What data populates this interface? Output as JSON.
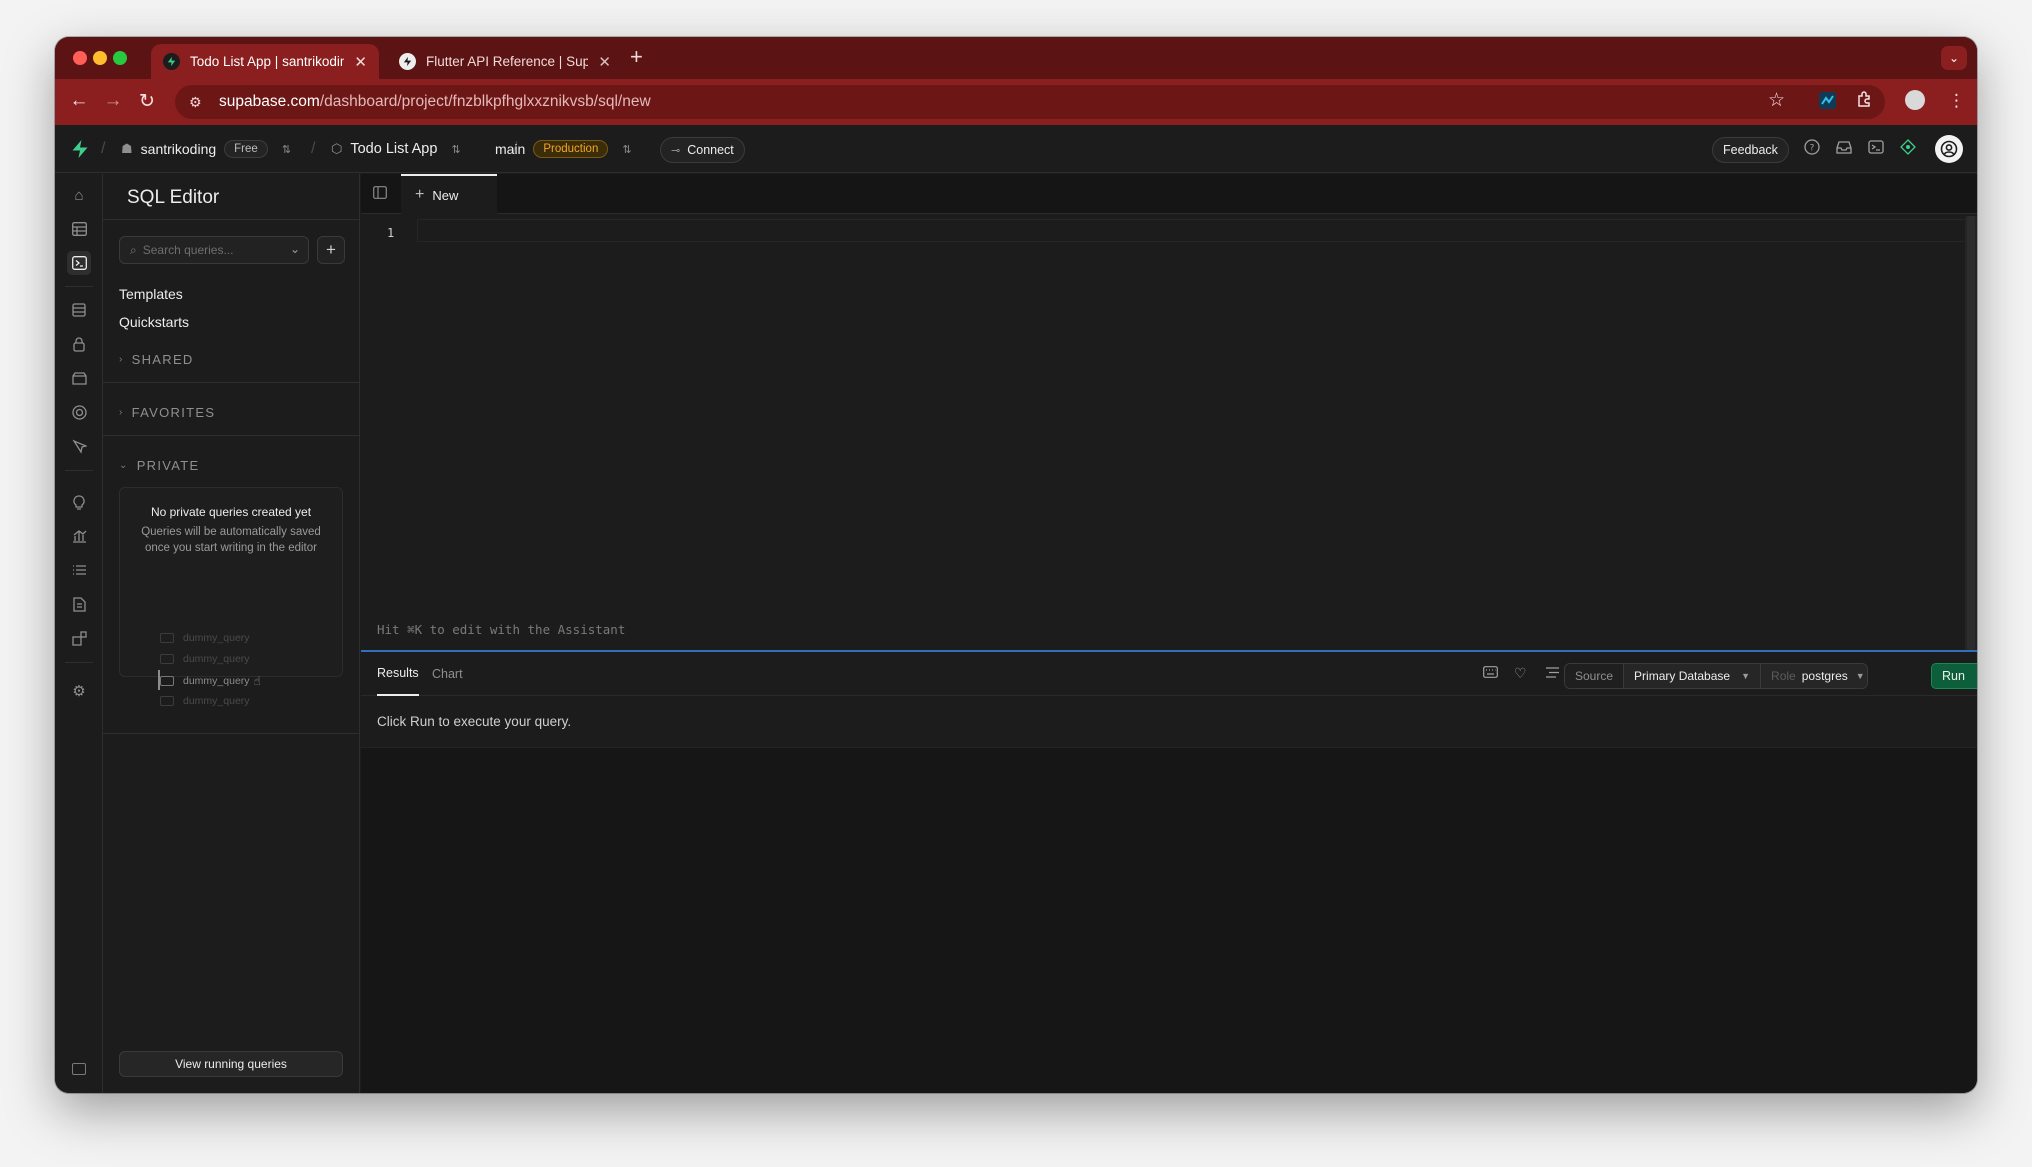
{
  "browser": {
    "tabs": [
      {
        "title": "Todo List App | santrikoding |",
        "active": true
      },
      {
        "title": "Flutter API Reference | Supab",
        "active": false
      }
    ],
    "url_host": "supabase.com",
    "url_path": "/dashboard/project/fnzblkpfhglxxznikvsb/sql/new"
  },
  "header": {
    "org_name": "santrikoding",
    "org_plan": "Free",
    "project_name": "Todo List App",
    "branch_name": "main",
    "branch_env": "Production",
    "connect_label": "Connect",
    "feedback_label": "Feedback"
  },
  "sidebar": {
    "title": "SQL Editor",
    "search_placeholder": "Search queries...",
    "links": [
      "Templates",
      "Quickstarts"
    ],
    "sections": {
      "shared": "SHARED",
      "favorites": "FAVORITES",
      "private": "PRIVATE"
    },
    "empty_title": "No private queries created yet",
    "empty_desc": "Queries will be automatically saved once you start writing in the editor",
    "dummy_queries": [
      "dummy_query",
      "dummy_query",
      "dummy_query",
      "dummy_query"
    ],
    "view_running": "View running queries"
  },
  "editor": {
    "tab_label": "New",
    "line_number": "1",
    "hint": "Hit ⌘K to edit with the Assistant"
  },
  "results": {
    "tabs": [
      "Results",
      "Chart"
    ],
    "source_label": "Source",
    "source_value": "Primary Database",
    "role_label": "Role",
    "role_value": "postgres",
    "run_label": "Run",
    "run_shortcut": "⌘ ↵",
    "message": "Click Run to execute your query."
  },
  "colors": {
    "browser_theme": "#8b1f1f",
    "supabase_green": "#3ecf8e",
    "production_badge": "#f5a623",
    "run_button": "#0c5f3a",
    "splitter_accent": "#2f6fbd"
  }
}
